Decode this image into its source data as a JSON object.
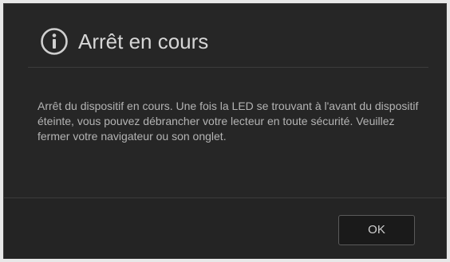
{
  "dialog": {
    "title": "Arrêt en cours",
    "title_icon": "info-icon",
    "message": "Arrêt du dispositif en cours. Une fois la LED se trouvant à l'avant du dispositif éteinte, vous pouvez débrancher votre lecteur en toute sécurité. Veuillez fermer votre navigateur ou son onglet.",
    "ok_label": "OK"
  },
  "colors": {
    "dialog_background": "#262626",
    "title_text": "#d6d6d6",
    "message_text": "#b4b4b4",
    "button_border": "#5a5a5a"
  }
}
